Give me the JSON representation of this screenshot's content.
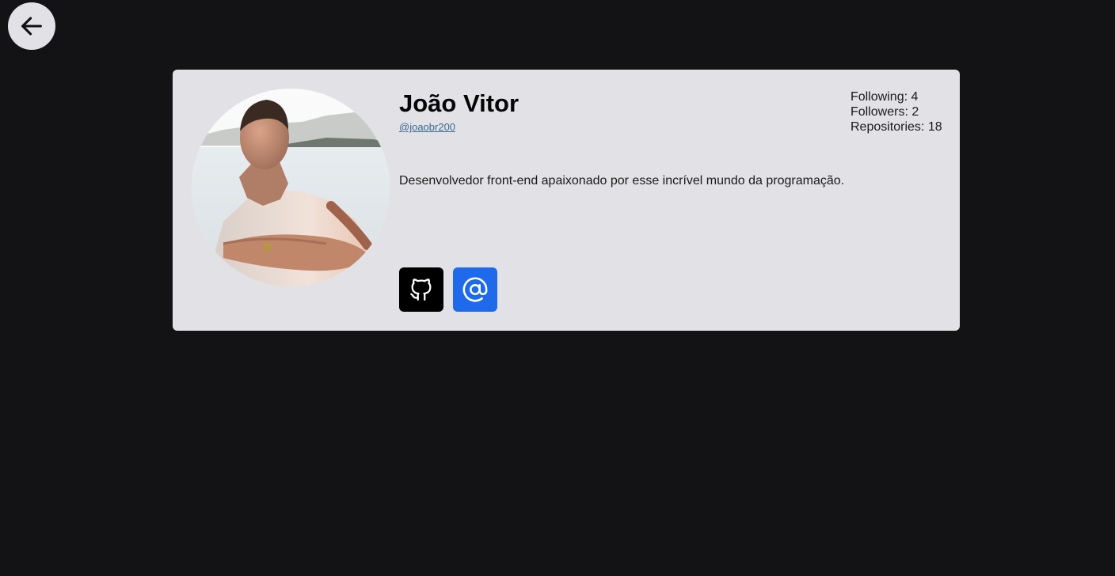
{
  "nav": {
    "back_icon": "arrow-left-icon"
  },
  "profile": {
    "name": "João Vitor",
    "handle": "@joaobr200",
    "bio": "Desenvolvedor front-end apaixonado por esse incrível mundo da programação.",
    "avatar_icon": "profile-photo"
  },
  "stats": {
    "following": "Following: 4",
    "followers": "Followers: 2",
    "repositories": "Repositories: 18"
  },
  "social": {
    "github": {
      "icon": "github-icon",
      "color": "#000000"
    },
    "email": {
      "icon": "at-sign-icon",
      "color": "#1f6aea"
    }
  },
  "colors": {
    "background": "#131315",
    "card": "#e2e1e6",
    "link": "#3a6a92"
  }
}
